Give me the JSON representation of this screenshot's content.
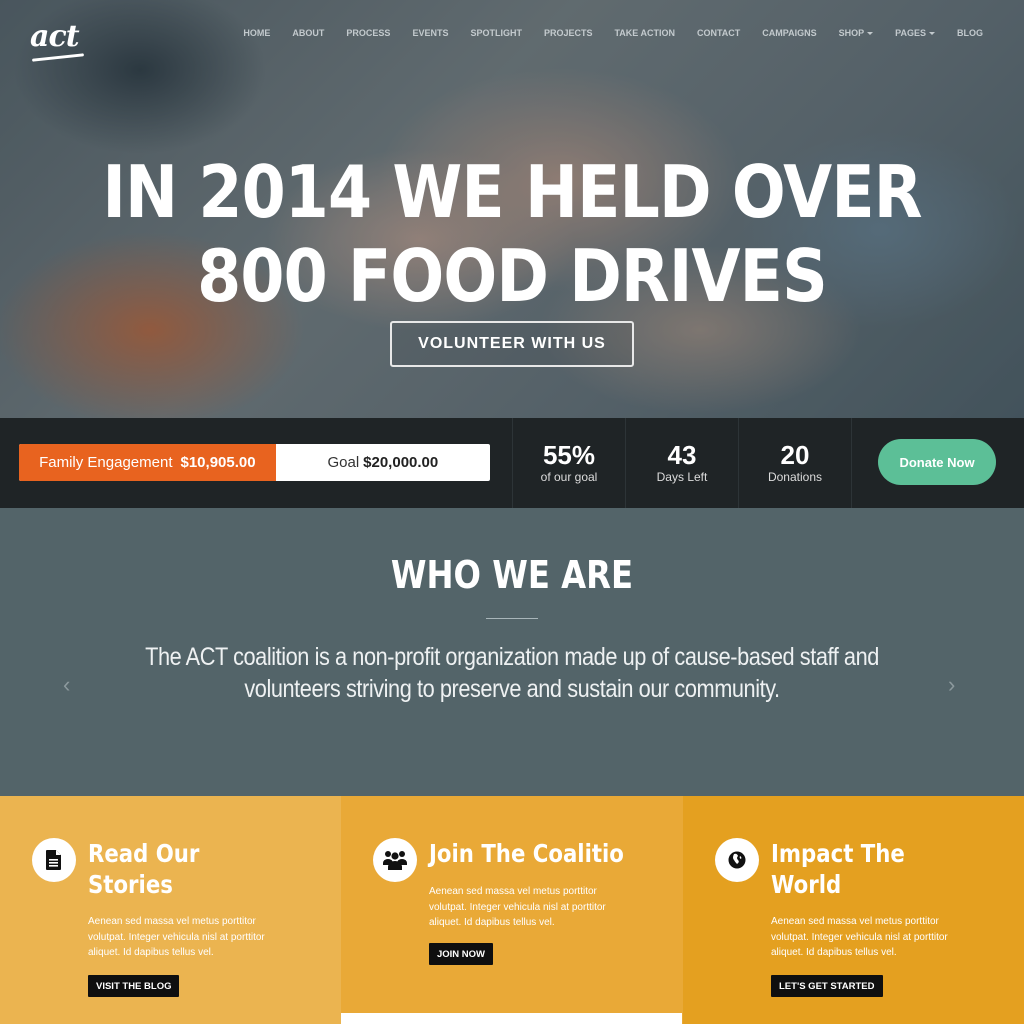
{
  "brand": {
    "logo_text": "act"
  },
  "nav": {
    "items": [
      {
        "label": "HOME",
        "dropdown": false
      },
      {
        "label": "ABOUT",
        "dropdown": false
      },
      {
        "label": "PROCESS",
        "dropdown": false
      },
      {
        "label": "EVENTS",
        "dropdown": false
      },
      {
        "label": "SPOTLIGHT",
        "dropdown": false
      },
      {
        "label": "PROJECTS",
        "dropdown": false
      },
      {
        "label": "TAKE ACTION",
        "dropdown": false
      },
      {
        "label": "CONTACT",
        "dropdown": false
      },
      {
        "label": "CAMPAIGNS",
        "dropdown": false
      },
      {
        "label": "SHOP",
        "dropdown": true
      },
      {
        "label": "PAGES",
        "dropdown": true
      },
      {
        "label": "BLOG",
        "dropdown": false
      }
    ]
  },
  "hero": {
    "title_line1": "IN 2014 WE HELD OVER",
    "title_line2": "800 FOOD DRIVES",
    "cta_label": "VOLUNTEER WITH US"
  },
  "campaign": {
    "raised_label": "Family Engagement",
    "raised_amount": "$10,905.00",
    "goal_label": "Goal",
    "goal_amount": "$20,000.00",
    "progress_fraction": 0.545,
    "stats": [
      {
        "value": "55%",
        "label": "of our goal"
      },
      {
        "value": "43",
        "label": "Days Left"
      },
      {
        "value": "20",
        "label": "Donations"
      }
    ],
    "donate_label": "Donate Now"
  },
  "who": {
    "title": "WHO WE ARE",
    "text": "The ACT coalition is a non-profit organization made up of cause-based staff and volunteers striving to preserve and sustain our community.",
    "prev_arrow": "‹",
    "next_arrow": "›"
  },
  "features": [
    {
      "icon": "document-icon",
      "title": "Read Our Stories",
      "text": "Aenean sed massa vel metus porttitor volutpat. Integer vehicula nisl at porttitor aliquet. Id dapibus tellus vel.",
      "button": "VISIT THE BLOG"
    },
    {
      "icon": "users-icon",
      "title": "Join The Coalitio",
      "text": "Aenean sed massa vel metus porttitor volutpat. Integer vehicula nisl at porttitor aliquet. Id dapibus tellus vel.",
      "button": "JOIN NOW"
    },
    {
      "icon": "globe-icon",
      "title": "Impact The World",
      "text": "Aenean sed massa vel metus porttitor volutpat. Integer vehicula nisl at porttitor aliquet. Id dapibus tellus vel.",
      "button": "LET'S GET STARTED"
    }
  ],
  "colors": {
    "accent_orange": "#e8631f",
    "donate_green": "#5cbf97",
    "stats_bg": "#1f2426",
    "who_bg": "#536469",
    "feature1_bg": "#ebb450",
    "feature2_bg": "#e9a937",
    "feature3_bg": "#e4a020"
  }
}
